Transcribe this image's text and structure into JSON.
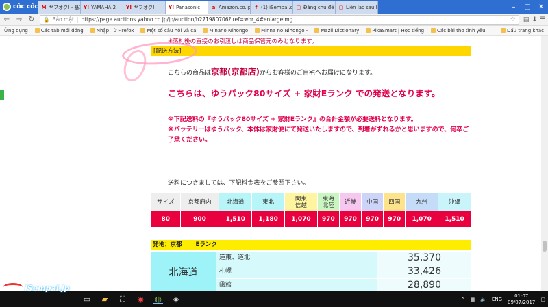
{
  "browser": {
    "brand": "cốc cốc",
    "tabs": [
      {
        "icon": "M",
        "label": "ヤフオク! - 基本"
      },
      {
        "icon": "Y!",
        "label": "YAMAHA 2"
      },
      {
        "icon": "Y!",
        "label": "ヤフオク!"
      },
      {
        "icon": "Y!",
        "label": "Panasonic"
      },
      {
        "icon": "a",
        "label": "Amazon.co.jp"
      },
      {
        "icon": "f",
        "label": "(1) iSempai.c"
      },
      {
        "icon": "▢",
        "label": "Đăng chủ đề"
      },
      {
        "icon": "▢",
        "label": "Liên lạc sau k"
      }
    ],
    "active_tab": 3,
    "secure_label": "Bảo mật",
    "url": "https://page.auctions.yahoo.co.jp/jp/auction/h271980706?iref=wbr_4#enlargeimg",
    "bookmarks": [
      "Ứng dụng",
      "Các tab mới đóng",
      "Nhập Từ Firefox",
      "Một số câu hỏi và cá",
      "Minano Nihongo",
      "Minna no Nihongo -",
      "Mazii Dictionary",
      "PikaSmart | Học tiếng",
      "Các bài thơ tình yêu"
    ],
    "bookmarks_right": "Dấu trang khác"
  },
  "page": {
    "top_note": "※落札後の直接のお引渡しは商品保管元のみとなります。",
    "section_title": "[配送方法]",
    "delivery_prefix": "こちらの商品は",
    "delivery_place": "京都(京都店)",
    "delivery_suffix": "からお客様のご自宅へお届けになります。",
    "headline": "こちらは、ゆうパック80サイズ + 家財Eランク での発送となります。",
    "notes": [
      "※下記送料の『ゆうパック80サイズ + 家財Eランク』の合計金額が必要送料となります。",
      "※バッテリーはゆうパック、本体は家財便にて発送いたしますので、到着がずれるかと思いますので、何卒ご了承ください。"
    ],
    "ref_note": "送料につきましては、下記料金表をご参照下さい。",
    "rate_table": {
      "headers": [
        "サイズ",
        "京都府内",
        "北海道",
        "東北",
        "関東\n信越",
        "東海\n北陸",
        "近畿",
        "中国",
        "四国",
        "九州",
        "沖縄"
      ],
      "values": [
        "80",
        "900",
        "1,510",
        "1,180",
        "1,070",
        "970",
        "970",
        "970",
        "970",
        "1,070",
        "1,510"
      ]
    },
    "origin_label": "発地：京都",
    "rank_label": "Eランク",
    "region": {
      "name": "北海道",
      "rows": [
        {
          "area": "道東、道北",
          "price": "35,370"
        },
        {
          "area": "札幌",
          "price": "33,426"
        },
        {
          "area": "函館",
          "price": "28,890"
        }
      ]
    }
  },
  "taskbar": {
    "watermark": "iSempai.jp",
    "lang": "ENG",
    "time": "01:07",
    "date": "09/07/2017"
  }
}
